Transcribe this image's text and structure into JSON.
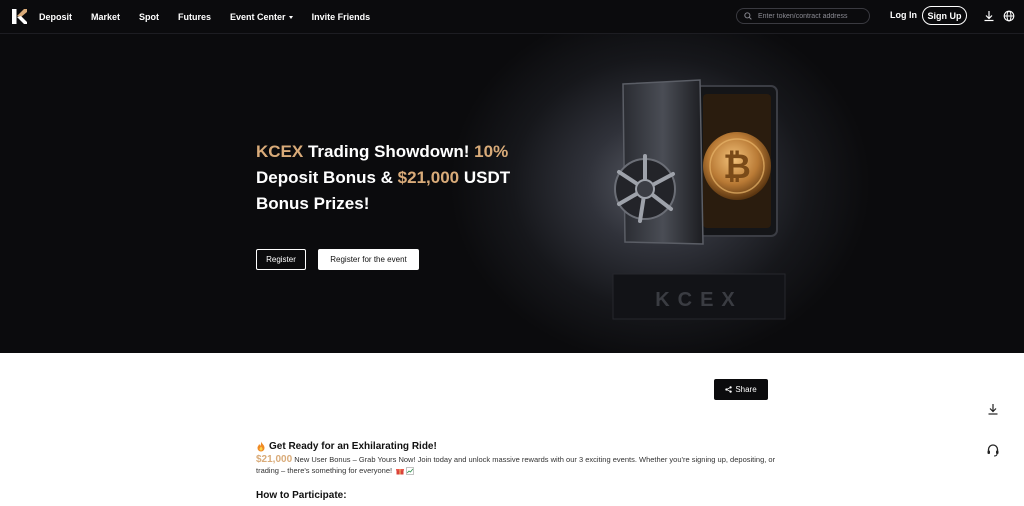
{
  "nav": {
    "logo": "K",
    "links": [
      {
        "label": "Deposit"
      },
      {
        "label": "Market"
      },
      {
        "label": "Spot"
      },
      {
        "label": "Futures"
      },
      {
        "label": "Event Center",
        "has_dropdown": true
      },
      {
        "label": "Invite Friends"
      }
    ],
    "search_placeholder": "Enter token/contract address",
    "login_label": "Log In",
    "signup_label": "Sign Up",
    "icons": [
      "download-icon",
      "globe-icon"
    ]
  },
  "hero": {
    "title_part1": "KCEX",
    "title_part2": " Trading Showdown! ",
    "title_part3": "10%",
    "title_part4": " Deposit Bonus & ",
    "title_part5": "$21,000",
    "title_part6": " USDT Bonus Prizes!",
    "register_label": "Register",
    "event_label": "Register for the event",
    "vault_text": "KCEX"
  },
  "share_label": "Share",
  "content": {
    "heading": "Get Ready for an Exhilarating Ride!",
    "bonus_amount": "$21,000",
    "intro": " New User Bonus – Grab Yours Now! Join today and unlock massive rewards with our 3 exciting events. Whether you're signing up, depositing, or trading – there's something for everyone!",
    "how_to": "How to Participate:"
  },
  "colors": {
    "accent_gold": "#d9ab79",
    "nav_bg": "#0b0b0d"
  }
}
